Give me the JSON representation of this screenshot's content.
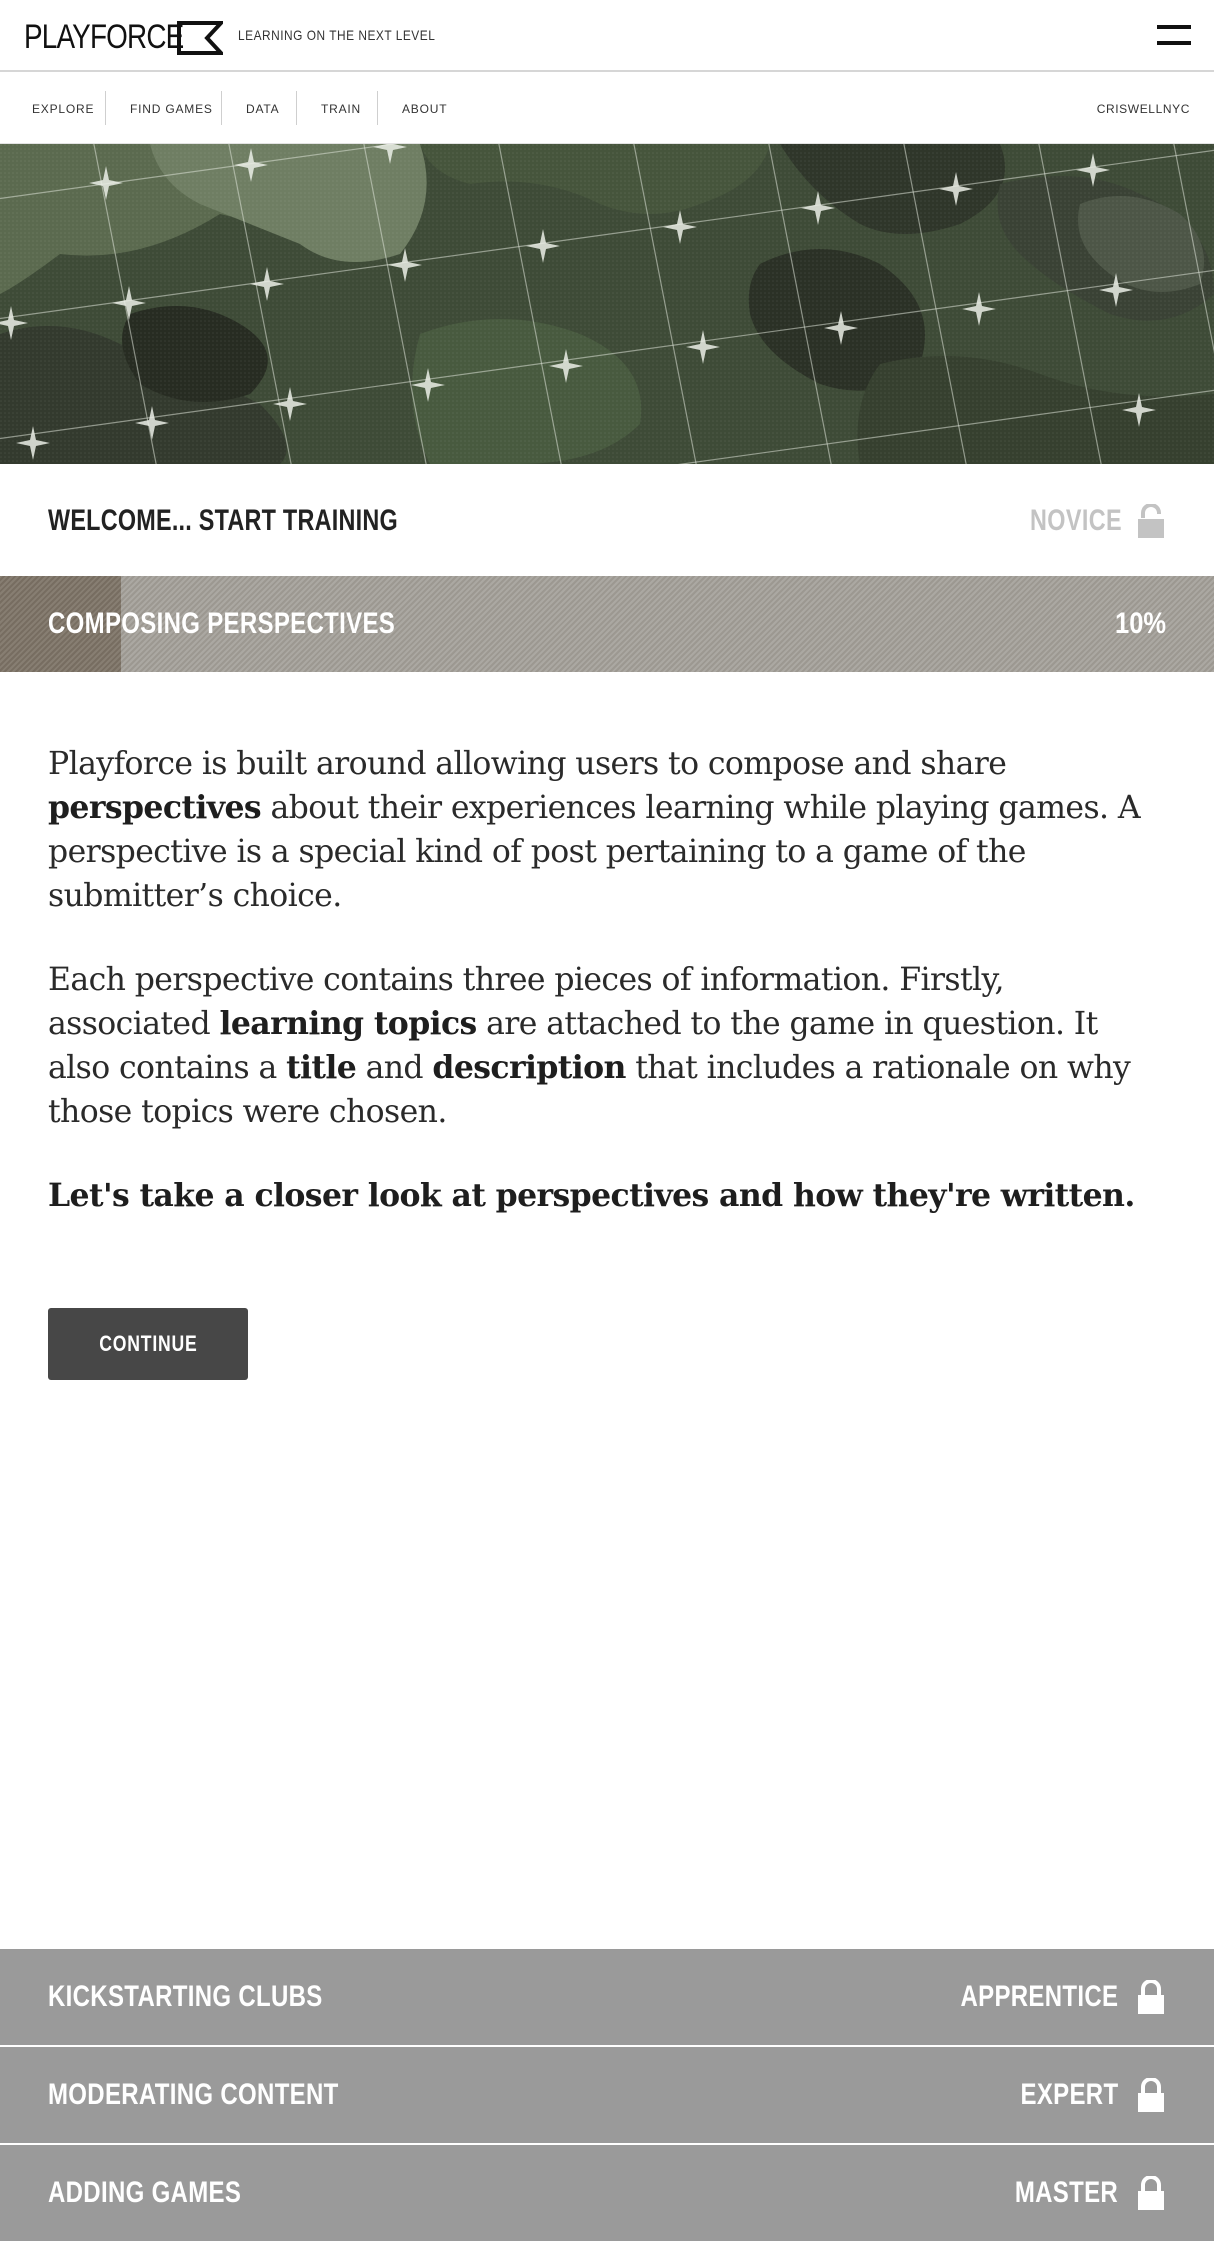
{
  "header": {
    "logo_text": "PLAYFORCE",
    "tagline": "LEARNING ON THE NEXT LEVEL",
    "menu_icon": "hamburger-menu-icon"
  },
  "nav": {
    "items": [
      {
        "label": "EXPLORE"
      },
      {
        "label": "FIND GAMES"
      },
      {
        "label": "DATA"
      },
      {
        "label": "TRAIN"
      },
      {
        "label": "ABOUT"
      }
    ],
    "user": "CRISWELLNYC"
  },
  "hero": {
    "image": "green camouflage grid banner"
  },
  "current_level": {
    "title": "WELCOME... START TRAINING",
    "badge": "NOVICE",
    "badge_icon": "unlocked-padlock-icon",
    "badge_color": "#c3c3c3"
  },
  "progress": {
    "label": "COMPOSING PERSPECTIVES",
    "percent_text": "10%",
    "value": 0.1,
    "fill_color": "#7d7366",
    "track_color": "#a29e97"
  },
  "content": {
    "p1": {
      "pre": "Playforce is built around allowing users to compose and share ",
      "bold": "perspectives",
      "post": " about their experiences learning while playing games. A perspective is a special kind of post pertaining to a game of the submitter’s choice."
    },
    "p2": {
      "pre": "Each perspective contains  three pieces of information. Firstly, associated ",
      "bold1": "learning topics",
      "mid1": " are attached to the game in question. It also contains a ",
      "bold2": "title",
      "mid2": " and ",
      "bold3": "description",
      "post": " that includes a rationale on why those topics were chosen."
    },
    "lead": "Let's take a closer look at perspectives and how they're written."
  },
  "continue_button": "CONTINUE",
  "locked_modules": [
    {
      "title": "KICKSTARTING CLUBS",
      "level": "APPRENTICE",
      "icon": "locked-padlock-icon"
    },
    {
      "title": "MODERATING CONTENT",
      "level": "EXPERT",
      "icon": "locked-padlock-icon"
    },
    {
      "title": "ADDING GAMES",
      "level": "MASTER",
      "icon": "locked-padlock-icon"
    }
  ],
  "colors": {
    "module_bg": "#9a9a9a",
    "button_bg": "#474747"
  }
}
